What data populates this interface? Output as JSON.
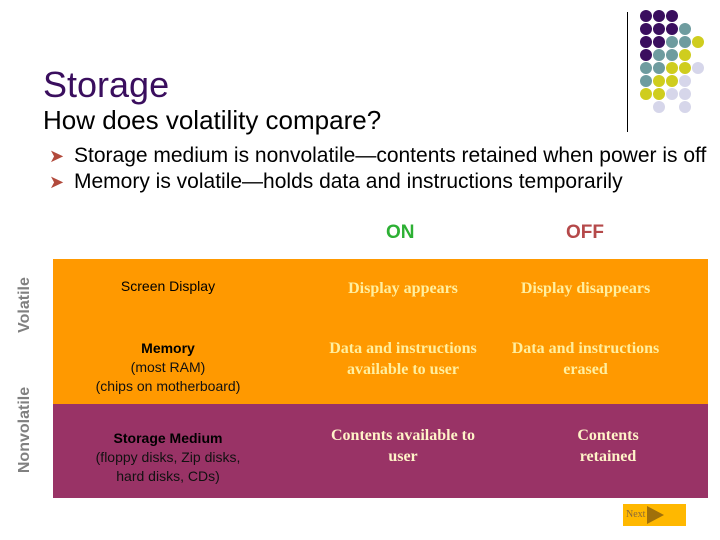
{
  "slide": {
    "title": "Storage",
    "subtitle": "How does volatility compare?",
    "bullets": [
      "Storage medium is nonvolatile—contents retained when power is off",
      "Memory is volatile—holds data and instructions temporarily"
    ],
    "bullet_icon": "arrowhead-bullet-icon"
  },
  "table": {
    "columns": {
      "on": "ON",
      "off": "OFF"
    },
    "groups": {
      "volatile": "Volatile",
      "nonvolatile": "Nonvolatile"
    },
    "rows": [
      {
        "label": "Screen Display",
        "sub": "",
        "on": "Display appears",
        "off": "Display disappears",
        "group": "volatile"
      },
      {
        "label": "Memory",
        "sub1": "(most RAM)",
        "sub2": "(chips on motherboard)",
        "on": "Data and instructions available to user",
        "off": "Data and instructions erased",
        "group": "volatile"
      },
      {
        "label": "Storage Medium",
        "sub1": "(floppy disks, Zip disks,",
        "sub2": "hard disks, CDs)",
        "on": "Contents available to user",
        "off": "Contents retained",
        "group": "nonvolatile"
      }
    ]
  },
  "navigation": {
    "next_label": "Next",
    "next_icon": "play-triangle-icon"
  },
  "colors": {
    "title": "#3a0e5e",
    "on": "#2db034",
    "off": "#b5494a",
    "volatile_band": "#ff9900",
    "nonvolatile_band": "#993366",
    "next_button": "#ffb800",
    "dot_purple": "#3a0e5e",
    "dot_teal": "#6e9c9f",
    "dot_yellow": "#cfcd1e",
    "dot_lavender": "#d6d6ea"
  },
  "decoration": {
    "dot_grid": [
      [
        "purple",
        "purple",
        "purple",
        null,
        null
      ],
      [
        "purple",
        "purple",
        "purple",
        "teal",
        null
      ],
      [
        "purple",
        "purple",
        "teal",
        "teal",
        "yellow"
      ],
      [
        "purple",
        "teal",
        "teal",
        "yellow",
        null
      ],
      [
        "teal",
        "teal",
        "yellow",
        "yellow",
        "lavender"
      ],
      [
        "teal",
        "yellow",
        "yellow",
        "lavender",
        null
      ],
      [
        "yellow",
        "yellow",
        "lavender",
        "lavender",
        null
      ],
      [
        null,
        "lavender",
        null,
        "lavender",
        null
      ]
    ]
  }
}
